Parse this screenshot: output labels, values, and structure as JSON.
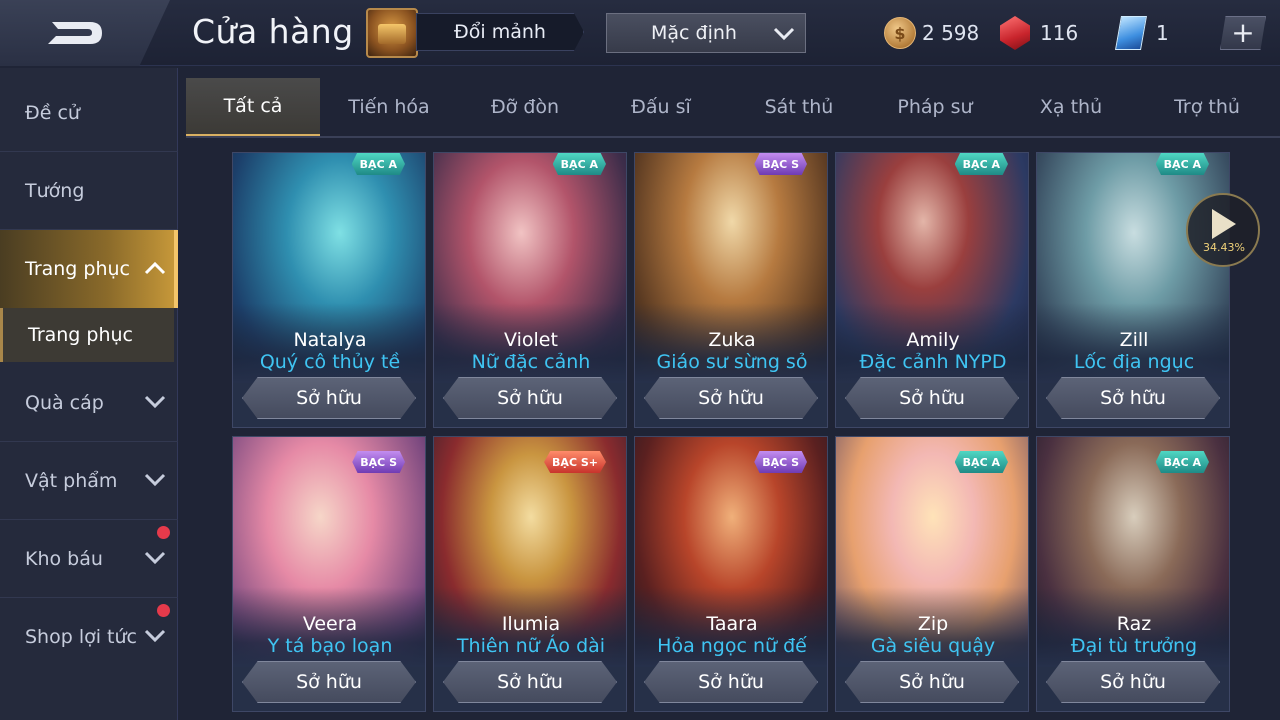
{
  "header": {
    "title": "Cửa hàng",
    "exchange_label": "Đổi mảnh",
    "sort_label": "Mặc định",
    "gold": "2 598",
    "rubies": "116",
    "vouchers": "1",
    "coin_symbol": "$"
  },
  "sidebar": {
    "items": [
      {
        "label": "Đề cử"
      },
      {
        "label": "Tướng"
      },
      {
        "label": "Trang phục"
      },
      {
        "label": "Trang phục"
      },
      {
        "label": "Quà cáp"
      },
      {
        "label": "Vật phẩm"
      },
      {
        "label": "Kho báu"
      },
      {
        "label": "Shop lợi tức"
      }
    ]
  },
  "tabs": [
    "Tất cả",
    "Tiến hóa",
    "Đỡ đòn",
    "Đấu sĩ",
    "Sát thủ",
    "Pháp sư",
    "Xạ thủ",
    "Trợ thủ"
  ],
  "cards": [
    {
      "hero": "Natalya",
      "skin": "Quý cô thủy tề",
      "tier": "BẠC A",
      "action": "Sở hữu"
    },
    {
      "hero": "Violet",
      "skin": "Nữ đặc cảnh",
      "tier": "BẠC A",
      "action": "Sở hữu"
    },
    {
      "hero": "Zuka",
      "skin": "Giáo sư sừng sỏ",
      "tier": "BẠC S",
      "action": "Sở hữu"
    },
    {
      "hero": "Amily",
      "skin": "Đặc cảnh NYPD",
      "tier": "BẠC A",
      "action": "Sở hữu"
    },
    {
      "hero": "Zill",
      "skin": "Lốc địa ngục",
      "tier": "BẠC A",
      "action": "Sở hữu"
    },
    {
      "hero": "Veera",
      "skin": "Y tá bạo loạn",
      "tier": "BẠC S",
      "action": "Sở hữu"
    },
    {
      "hero": "Ilumia",
      "skin": "Thiên nữ Áo dài",
      "tier": "BẠC S+",
      "action": "Sở hữu"
    },
    {
      "hero": "Taara",
      "skin": "Hỏa ngọc nữ đế",
      "tier": "BẠC S",
      "action": "Sở hữu"
    },
    {
      "hero": "Zip",
      "skin": "Gà siêu quậy",
      "tier": "BẠC A",
      "action": "Sở hữu"
    },
    {
      "hero": "Raz",
      "skin": "Đại tù trưởng",
      "tier": "BẠC A",
      "action": "Sở hữu"
    }
  ],
  "video": {
    "progress": "34.43%"
  },
  "colors": {
    "accent_gold": "#d9b062",
    "skin_name": "#3fc4f2",
    "notification": "#e53a4b"
  }
}
